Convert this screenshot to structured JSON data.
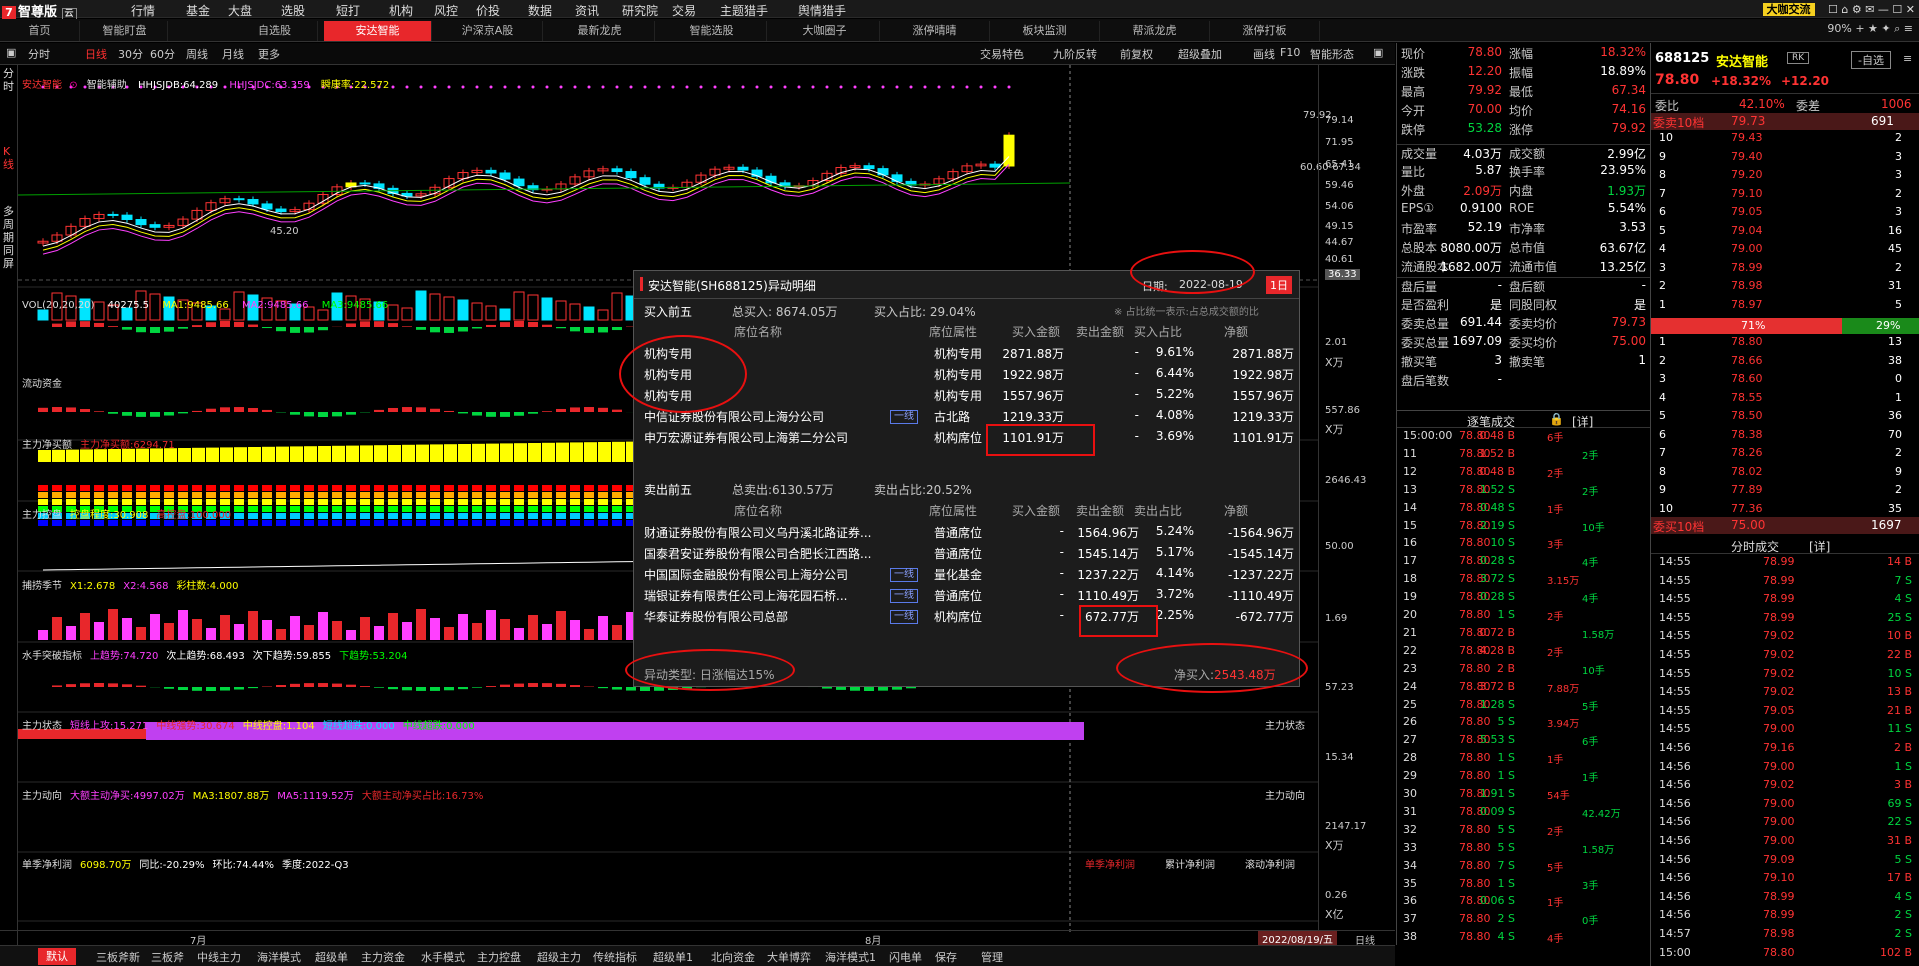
{
  "app": {
    "brand": "智尊版",
    "cloud": "云",
    "menu": [
      "行情",
      "基金",
      "大盘",
      "选股",
      "短打",
      "机构",
      "风控",
      "价投",
      "数据",
      "资讯",
      "研究院",
      "交易",
      "主题猎手",
      "舆情猎手"
    ],
    "exchange_btn": "大咖交流",
    "zoom": "90%"
  },
  "tabs": [
    "首页",
    "智能盯盘",
    "自选股",
    "安达智能",
    "沪深京A股",
    "最新龙虎",
    "智能选股",
    "大咖圈子",
    "涨停晴晴",
    "板块监测",
    "帮派龙虎",
    "涨停打板"
  ],
  "active_tab": "安达智能",
  "toolbar": {
    "left": [
      "分时",
      "日线",
      "30分",
      "60分",
      "周线",
      "月线",
      "更多"
    ],
    "selected": "日线",
    "right": [
      "交易特色",
      "九阶反转",
      "前复权",
      "超级叠加",
      "画线",
      "F10",
      "智能形态"
    ]
  },
  "leftstrip": [
    "分时",
    "K线",
    "多周期同屏"
  ],
  "kline": {
    "name": "安达智能",
    "indicator": "智能辅助",
    "hhjs_djb": "HHJSJDB:64.289",
    "hhjs_jdc": "HHJSJDC:63.359",
    "ratio": "瞬康率:22.572",
    "high_label": "79.92",
    "low_label": "45.20",
    "arrow_label": "60.60-67.34"
  },
  "axis_k": [
    "79.14",
    "71.95",
    "65.41",
    "59.46",
    "54.06",
    "49.15",
    "44.67",
    "40.61",
    "36.33"
  ],
  "vol": {
    "label": "VOL(20,20,20)",
    "v": "40275.5",
    "ma1": "MA1:9485.66",
    "ma2": "MA2:9485.66",
    "ma3": "MA3:9485.66",
    "axis": "2.01",
    "unit": "X万"
  },
  "panels": [
    {
      "name": "流动资金",
      "axis": "557.86",
      "unit": "X万"
    },
    {
      "name": "主力净买额",
      "sub": "主力净买额:6294.71",
      "axis": "2646.43"
    },
    {
      "name": "主力控盘",
      "sub1": "控盘程度:30.908",
      "sub2": "高控盘:100.000",
      "axis": "50.00"
    },
    {
      "name": "捕捞季节",
      "sub1": "X1:2.678",
      "sub2": "X2:4.568",
      "sub3": "彩柱数:4.000",
      "axis": "1.69"
    },
    {
      "name": "水手突破指标",
      "sub1": "上趋势:74.720",
      "sub2": "次上趋势:68.493",
      "sub3": "次下趋势:59.855",
      "sub4": "下趋势:53.204",
      "axis": "57.23"
    },
    {
      "name": "主力状态",
      "sub1": "短线上攻:15.271",
      "sub2": "中线强势:30.674",
      "sub3": "中线控盘:1.104",
      "sub4": "短线超跌:0.000",
      "sub5": "中线超跌:0.000",
      "axis": "15.34",
      "right": "主力状态"
    },
    {
      "name": "主力动向",
      "sub1": "大额主动净买:4997.02万",
      "sub2": "MA3:1807.88万",
      "sub3": "MA5:1119.52万",
      "sub4": "大额主动净买占比:16.73%",
      "axis": "2147.17",
      "unit": "X万",
      "right": "主力动向"
    },
    {
      "name": "单季净利润",
      "sub1": "6098.70万",
      "sub2": "同比:-20.29%",
      "sub3": "环比:74.44%",
      "sub4": "季度:2022-Q3",
      "axis": "0.26",
      "unit": "X亿",
      "r1": "单季净利润",
      "r2": "累计净利润",
      "r3": "滚动净利润"
    }
  ],
  "xaxis": {
    "jul": "7月",
    "aug": "8月",
    "date": "2022/08/19/五",
    "daily": "日线"
  },
  "bottom_tabs": [
    "默认",
    "三板斧新",
    "三板斧",
    "中线主力",
    "海洋模式",
    "超级单",
    "主力资金",
    "水手模式",
    "主力控盘",
    "超级主力",
    "传统指标",
    "超级单1",
    "北向资金",
    "大单博弈",
    "海洋模式1",
    "闪电单",
    "保存",
    "管理"
  ],
  "popup": {
    "title": "安达智能(SH688125)异动明细",
    "date_label": "日期:",
    "date": "2022-08-19",
    "period": "1日",
    "buy_title": "买入前五",
    "buy_total": "总买入: 8674.05万",
    "buy_ratio": "买入占比: 29.04%",
    "note": "※ 占比统一表示:占总成交额的比",
    "cols": [
      "席位名称",
      "席位属性",
      "买入金额",
      "卖出金额",
      "买入占比",
      "净额"
    ],
    "buy": [
      [
        "机构专用",
        "",
        "机构专用",
        "2871.88万",
        "-",
        "9.61%",
        "2871.88万"
      ],
      [
        "机构专用",
        "",
        "机构专用",
        "1922.98万",
        "-",
        "6.44%",
        "1922.98万"
      ],
      [
        "机构专用",
        "",
        "机构专用",
        "1557.96万",
        "-",
        "5.22%",
        "1557.96万"
      ],
      [
        "中信证券股份有限公司上海分公司",
        "一线",
        "古北路",
        "1219.33万",
        "-",
        "4.08%",
        "1219.33万"
      ],
      [
        "申万宏源证券有限公司上海第二分公司",
        "",
        "机构席位",
        "1101.91万",
        "-",
        "3.69%",
        "1101.91万"
      ]
    ],
    "sell_title": "卖出前五",
    "sell_total": "总卖出:6130.57万",
    "sell_ratio": "卖出占比:20.52%",
    "sell_cols": [
      "席位名称",
      "席位属性",
      "买入金额",
      "卖出金额",
      "卖出占比",
      "净额"
    ],
    "sell": [
      [
        "财通证券股份有限公司义乌丹溪北路证券...",
        "",
        "普通席位",
        "-",
        "1564.96万",
        "5.24%",
        "-1564.96万"
      ],
      [
        "国泰君安证券股份有限公司合肥长江西路...",
        "",
        "普通席位",
        "-",
        "1545.14万",
        "5.17%",
        "-1545.14万"
      ],
      [
        "中国国际金融股份有限公司上海分公司",
        "一线",
        "量化基金",
        "-",
        "1237.22万",
        "4.14%",
        "-1237.22万"
      ],
      [
        "瑞银证券有限责任公司上海花园石桥...",
        "一线",
        "普通席位",
        "-",
        "1110.49万",
        "3.72%",
        "-1110.49万"
      ],
      [
        "华泰证券股份有限公司总部",
        "一线",
        "机构席位",
        "-",
        "672.77万",
        "2.25%",
        "-672.77万"
      ]
    ],
    "type": "异动类型: 日涨幅达15%",
    "net_label": "净买入:",
    "net": "2543.48万"
  },
  "quote": [
    [
      "现价",
      "78.80",
      "red",
      "涨幅",
      "18.32%",
      "red"
    ],
    [
      "涨跌",
      "12.20",
      "red",
      "振幅",
      "18.89%",
      "white"
    ],
    [
      "最高",
      "79.92",
      "red",
      "最低",
      "67.34",
      "red"
    ],
    [
      "今开",
      "70.00",
      "red",
      "均价",
      "74.16",
      "red"
    ],
    [
      "跌停",
      "53.28",
      "green",
      "涨停",
      "79.92",
      "red"
    ],
    [
      "成交量",
      "4.03万",
      "white",
      "成交额",
      "2.99亿",
      "white"
    ],
    [
      "量比",
      "5.87",
      "white",
      "换手率",
      "23.95%",
      "white"
    ],
    [
      "外盘",
      "2.09万",
      "red",
      "内盘",
      "1.93万",
      "green"
    ],
    [
      "EPS①",
      "0.9100",
      "white",
      "ROE",
      "5.54%",
      "white"
    ],
    [
      "市盈率",
      "52.19",
      "white",
      "市净率",
      "3.53",
      "white"
    ],
    [
      "总股本",
      "8080.00万",
      "white",
      "总市值",
      "63.67亿",
      "white"
    ],
    [
      "流通股本",
      "1682.00万",
      "white",
      "流通市值",
      "13.25亿",
      "white"
    ],
    [
      "盘后量",
      "-",
      "white",
      "盘后额",
      "-",
      "white"
    ],
    [
      "是否盈利",
      "是",
      "white",
      "同股同权",
      "是",
      "white"
    ],
    [
      "委卖总量",
      "691.44",
      "white",
      "委卖均价",
      "79.73",
      "red"
    ],
    [
      "委买总量",
      "1697.09",
      "white",
      "委买均价",
      "75.00",
      "red"
    ],
    [
      "撤买笔",
      "3",
      "white",
      "撤卖笔",
      "1",
      "white"
    ],
    [
      "盘后笔数",
      "-",
      "white",
      "",
      "",
      ""
    ]
  ],
  "trades_header": "逐笔成交",
  "trades_detail": "[详]",
  "trades": [
    [
      "15:00:00",
      "78.80",
      "0.48 B",
      "6手"
    ],
    [
      "11",
      "78.80",
      "1.52 B",
      "2手"
    ],
    [
      "12",
      "78.80",
      "0.48 B",
      "2手"
    ],
    [
      "13",
      "78.80",
      "1.52 S",
      "2手"
    ],
    [
      "14",
      "78.80",
      "0.48 S",
      "1手"
    ],
    [
      "15",
      "78.80",
      "2.19 S",
      "10手"
    ],
    [
      "16",
      "78.80",
      "10 S",
      "3手"
    ],
    [
      "17",
      "78.80",
      "0.28 S",
      "4手"
    ],
    [
      "18",
      "78.80",
      "3.72 S",
      "3.15万"
    ],
    [
      "19",
      "78.80",
      "0.28 S",
      "4手"
    ],
    [
      "20",
      "78.80",
      "1 S",
      "2手"
    ],
    [
      "21",
      "78.80",
      "0.72 B",
      "1.58万"
    ],
    [
      "22",
      "78.80",
      "4.28 B",
      "2手"
    ],
    [
      "23",
      "78.80",
      "2 B",
      "10手"
    ],
    [
      "24",
      "78.80",
      "3.72 B",
      "7.88万"
    ],
    [
      "25",
      "78.80",
      "1.28 S",
      "5手"
    ],
    [
      "26",
      "78.80",
      "5 S",
      "3.94万"
    ],
    [
      "27",
      "78.80",
      "5.53 S",
      "6手"
    ],
    [
      "28",
      "78.80",
      "1 S",
      "1手"
    ],
    [
      "29",
      "78.80",
      "1 S",
      "1手"
    ],
    [
      "30",
      "78.80",
      "1.91 S",
      "54手"
    ],
    [
      "31",
      "78.80",
      "0.09 S",
      "42.42万"
    ],
    [
      "32",
      "78.80",
      "5 S",
      "2手"
    ],
    [
      "33",
      "78.80",
      "5 S",
      "1.58万"
    ],
    [
      "34",
      "78.80",
      "7 S",
      "5手"
    ],
    [
      "35",
      "78.80",
      "1 S",
      "3手"
    ],
    [
      "36",
      "78.80",
      "0.06 S",
      "1手"
    ],
    [
      "37",
      "78.80",
      "2 S",
      "0手"
    ],
    [
      "38",
      "78.80",
      "4 S",
      "4手"
    ]
  ],
  "ob": {
    "code": "688125",
    "name": "安达智能",
    "tag": "RK",
    "self_btn": "-自选",
    "price": "78.80",
    "chg_pct": "+18.32%",
    "chg": "+12.20",
    "weibi_label": "委比",
    "weibi": "42.10%",
    "weicha_label": "委差",
    "weicha": "1006",
    "sell10_label": "委卖10档",
    "sell10_price": "79.73",
    "sell10_vol": "691",
    "asks": [
      [
        "10",
        "79.43",
        "2"
      ],
      [
        "9",
        "79.40",
        "3"
      ],
      [
        "8",
        "79.20",
        "3"
      ],
      [
        "7",
        "79.10",
        "2"
      ],
      [
        "6",
        "79.05",
        "3"
      ],
      [
        "5",
        "79.04",
        "16"
      ],
      [
        "4",
        "79.00",
        "45"
      ],
      [
        "3",
        "78.99",
        "2"
      ],
      [
        "2",
        "78.98",
        "31"
      ],
      [
        "1",
        "78.97",
        "5"
      ]
    ],
    "bar_red": "71%",
    "bar_green": "29%",
    "bar_red_frac": 0.71,
    "bids": [
      [
        "1",
        "78.80",
        "13"
      ],
      [
        "2",
        "78.66",
        "38"
      ],
      [
        "3",
        "78.60",
        "0"
      ],
      [
        "4",
        "78.55",
        "1"
      ],
      [
        "5",
        "78.50",
        "36"
      ],
      [
        "6",
        "78.38",
        "70"
      ],
      [
        "7",
        "78.26",
        "2"
      ],
      [
        "8",
        "78.02",
        "9"
      ],
      [
        "9",
        "77.89",
        "2"
      ],
      [
        "10",
        "77.36",
        "35"
      ]
    ],
    "buy10_label": "委买10档",
    "buy10_price": "75.00",
    "buy10_vol": "1697",
    "ticks_header": "分时成交",
    "ticks_detail": "[详]",
    "ticks": [
      [
        "14:55",
        "78.99",
        "14 B"
      ],
      [
        "14:55",
        "78.99",
        "7 S"
      ],
      [
        "14:55",
        "78.99",
        "4 S"
      ],
      [
        "14:55",
        "78.99",
        "25 S"
      ],
      [
        "14:55",
        "79.02",
        "10 B"
      ],
      [
        "14:55",
        "79.02",
        "22 B"
      ],
      [
        "14:55",
        "79.02",
        "10 S"
      ],
      [
        "14:55",
        "79.02",
        "13 B"
      ],
      [
        "14:55",
        "79.05",
        "21 B"
      ],
      [
        "14:55",
        "79.00",
        "11 S"
      ],
      [
        "14:56",
        "79.16",
        "2 B"
      ],
      [
        "14:56",
        "79.00",
        "1 S"
      ],
      [
        "14:56",
        "79.02",
        "3 B"
      ],
      [
        "14:56",
        "79.00",
        "69 S"
      ],
      [
        "14:56",
        "79.00",
        "22 S"
      ],
      [
        "14:56",
        "79.00",
        "31 B"
      ],
      [
        "14:56",
        "79.09",
        "5 S"
      ],
      [
        "14:56",
        "79.10",
        "17 B"
      ],
      [
        "14:56",
        "78.99",
        "4 S"
      ],
      [
        "14:56",
        "78.99",
        "2 S"
      ],
      [
        "14:57",
        "78.98",
        "2 S"
      ],
      [
        "15:00",
        "78.80",
        "102 B"
      ]
    ]
  }
}
